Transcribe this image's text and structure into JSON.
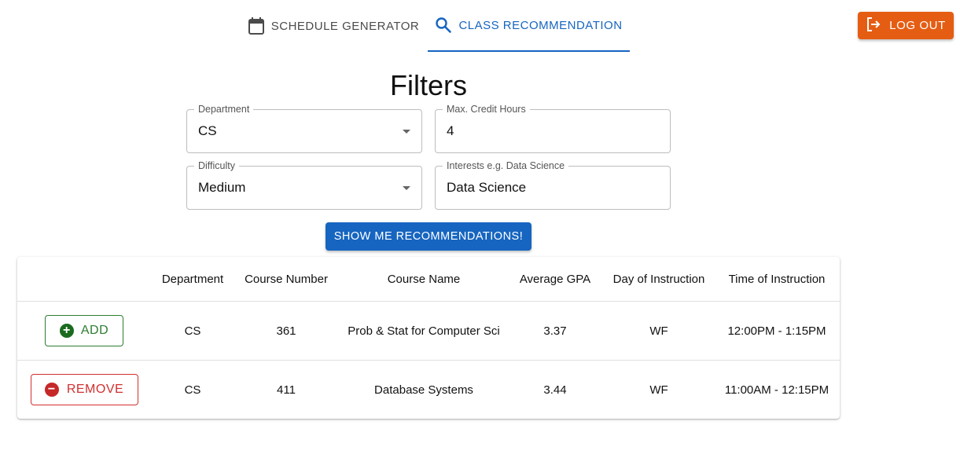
{
  "nav": {
    "tabs": [
      {
        "label": "SCHEDULE GENERATOR",
        "icon": "calendar-icon",
        "active": false
      },
      {
        "label": "CLASS RECOMMENDATION",
        "icon": "search-icon",
        "active": true
      }
    ],
    "logout_label": "LOG OUT",
    "logout_icon": "logout-icon"
  },
  "filters": {
    "title": "Filters",
    "department": {
      "label": "Department",
      "value": "CS"
    },
    "max_credit_hours": {
      "label": "Max. Credit Hours",
      "value": "4"
    },
    "difficulty": {
      "label": "Difficulty",
      "value": "Medium"
    },
    "interests": {
      "label": "Interests e.g. Data Science",
      "value": "Data Science"
    },
    "submit_label": "SHOW ME RECOMMENDATIONS!"
  },
  "table": {
    "headers": [
      "",
      "Department",
      "Course Number",
      "Course Name",
      "Average GPA",
      "Day of Instruction",
      "Time of Instruction"
    ],
    "rows": [
      {
        "action": "ADD",
        "department": "CS",
        "course_number": "361",
        "course_name": "Prob & Stat for Computer Sci",
        "avg_gpa": "3.37",
        "day": "WF",
        "time": "12:00PM - 1:15PM"
      },
      {
        "action": "REMOVE",
        "department": "CS",
        "course_number": "411",
        "course_name": "Database Systems",
        "avg_gpa": "3.44",
        "day": "WF",
        "time": "11:00AM - 12:15PM"
      }
    ]
  },
  "colors": {
    "primary": "#1665c0",
    "logout": "#e55d12",
    "add": "#2e7d32",
    "remove": "#d32f2f"
  }
}
